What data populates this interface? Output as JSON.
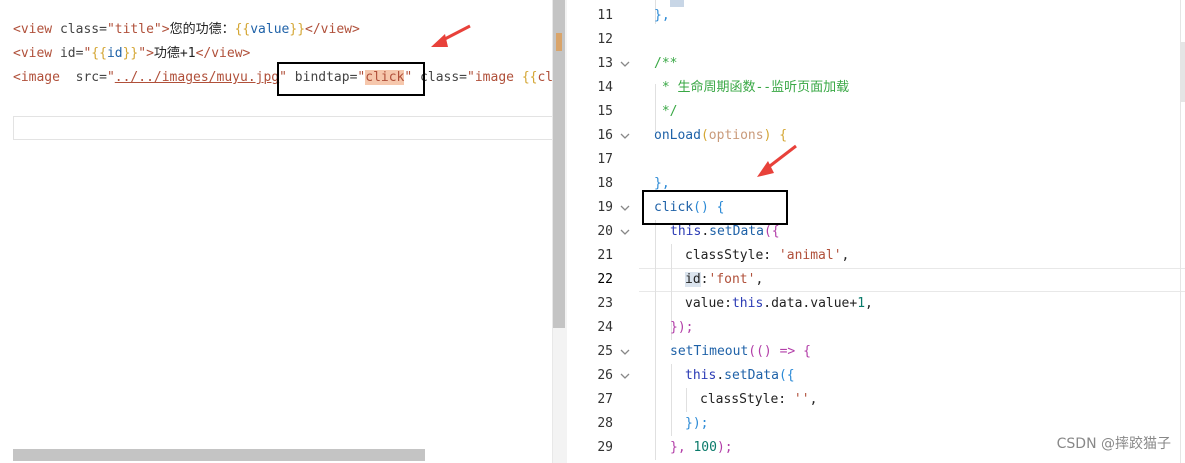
{
  "left_editor": {
    "lines": [
      {
        "tag_open": "<view",
        "attr_class": " class=",
        "class_value": "\"title\"",
        "close_bracket": ">",
        "text": "您的功德：",
        "brace_open": "{{",
        "expr": "value",
        "brace_close": "}}",
        "tag_close": "</view>"
      },
      {
        "tag_open": "<view",
        "attr_id": " id=",
        "quote_open": "\"",
        "brace_open": "{{",
        "expr": "id",
        "brace_close": "}}",
        "quote_close": "\"",
        "close_bracket": ">",
        "text": "功德+1",
        "tag_close": "</view>"
      },
      {
        "tag_open": "<image",
        "attr_src": "  src=",
        "quote_open": "\"",
        "src_value": "../../images/muyu.jpg",
        "quote_close": "\"",
        "attr_bindtap": " bindtap=",
        "bindtap_quote_open": "\"",
        "bindtap_value": "click",
        "bindtap_quote_close": "\"",
        "attr_class": " class=",
        "class_quote": "\"image ",
        "brace_open": "{{",
        "class_expr": "class"
      }
    ]
  },
  "right_editor": {
    "line_numbers": [
      "11",
      "12",
      "13",
      "14",
      "15",
      "16",
      "17",
      "18",
      "19",
      "20",
      "21",
      "22",
      "23",
      "24",
      "25",
      "26",
      "27",
      "28",
      "29"
    ],
    "active_line": "22",
    "fold_markers": [
      "13",
      "16",
      "19",
      "20",
      "25",
      "26"
    ],
    "code": {
      "l11": "},",
      "l13": "/**",
      "l14": " * 生命周期函数--监听页面加载",
      "l15": " */",
      "l16_fn": "onLoad",
      "l16_p1": "(",
      "l16_arg": "options",
      "l16_p2": ") {",
      "l18": "},",
      "l19_fn": "click",
      "l19_rest": "() {",
      "l20_this": "this",
      "l20_dot": ".",
      "l20_fn": "setData",
      "l20_p": "({",
      "l21_prop": "classStyle: ",
      "l21_val": "'animal'",
      "l21_comma": ",",
      "l22_prop": "id",
      "l22_colon": ":",
      "l22_val": "'font'",
      "l22_comma": ",",
      "l23_prop": "value:",
      "l23_this": "this",
      "l23_rest": ".data.value+",
      "l23_num": "1",
      "l23_comma": ",",
      "l24": "});",
      "l25_fn": "setTimeout",
      "l25_rest": "(() => {",
      "l26_this": "this",
      "l26_dot": ".",
      "l26_fn": "setData",
      "l26_p": "({",
      "l27_prop": "classStyle: ",
      "l27_val": "''",
      "l27_comma": ",",
      "l28": "});",
      "l29_pre": "}, ",
      "l29_num": "100",
      "l29_post": ");"
    }
  },
  "watermark": "CSDN @摔跤猫子",
  "colors": {
    "tag": "#b0503a",
    "comment": "#39a845",
    "function": "#1f62a8",
    "keyword": "#2b3bb5",
    "highlight": "#f6c7ac",
    "arrow": "#e8413a"
  },
  "icons": {
    "fold": "chevron-down-icon",
    "arrow": "red-arrow-icon"
  }
}
